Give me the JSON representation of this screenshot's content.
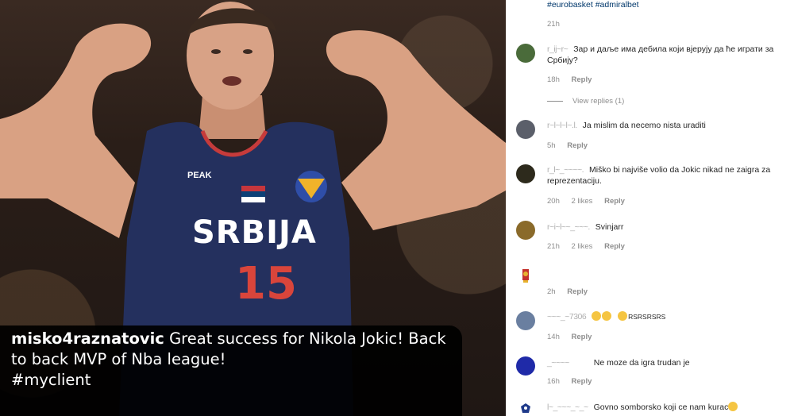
{
  "post": {
    "caption_user": "misko4raznatovic",
    "caption_text": "Great success for Nikola Jokic! Back to back MVP of Nba league!",
    "caption_hashtag": "#myclient",
    "jersey": {
      "brand": "PEAK",
      "team": "SRBIJA",
      "number": "15"
    }
  },
  "header": {
    "tags": "#eurobasket #admiralbet",
    "time": "21h"
  },
  "comments": [
    {
      "name": "r_ij~r~",
      "text": "Зар и даље има дебила који вјерују да ће играти за Србију?",
      "time": "18h",
      "likes": "",
      "reply": "Reply",
      "view_replies": "View replies (1)",
      "avatar_color": "#4a6b3a"
    },
    {
      "name": "r~l~l~l~.l.",
      "text": "Ja mislim da necemo nista uraditi",
      "time": "5h",
      "likes": "",
      "reply": "Reply",
      "avatar_color": "#5b5f6a"
    },
    {
      "name": "r_l~_~~~~.",
      "text": "Miško bi najviše volio da Jokic nikad ne zaigra za reprezentaciju.",
      "time": "20h",
      "likes": "2 likes",
      "reply": "Reply",
      "avatar_color": "#2d2a1c"
    },
    {
      "name": "r~i~l~~_~~~.",
      "text": "Svinjarr",
      "time": "21h",
      "likes": "2 likes",
      "reply": "Reply",
      "avatar_color": "#8a6a2a"
    },
    {
      "name": "",
      "text": "",
      "time": "2h",
      "likes": "",
      "reply": "Reply",
      "avatar_color": "#ffffff"
    },
    {
      "name": "~~~_~7306",
      "text": "RSRSRSRS",
      "time": "14h",
      "likes": "",
      "reply": "Reply",
      "avatar_color": "#6a7fa0"
    },
    {
      "name": "_~~~~",
      "text": "Ne moze da igra trudan je",
      "time": "16h",
      "likes": "",
      "reply": "Reply",
      "avatar_color": "#1f2aa8"
    },
    {
      "name": "l~_~~~_~_~",
      "text": "Govno somborsko koji ce nam kurac",
      "time": "",
      "likes": "",
      "reply": "",
      "avatar_color": "#ffffff"
    }
  ]
}
